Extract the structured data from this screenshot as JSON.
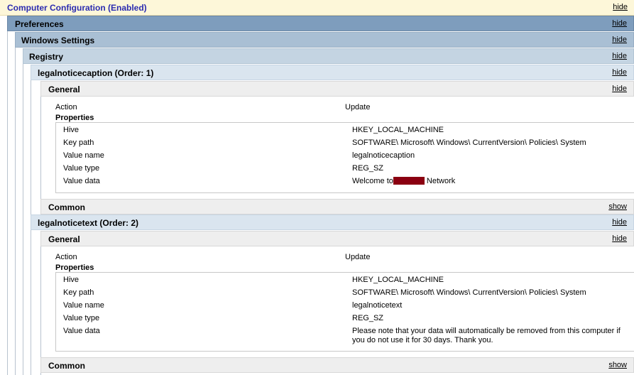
{
  "computer_configuration": {
    "title": "Computer Configuration (Enabled)",
    "toggle": "hide"
  },
  "preferences": {
    "title": "Preferences",
    "toggle": "hide"
  },
  "windows_settings": {
    "title": "Windows Settings",
    "toggle": "hide"
  },
  "registry": {
    "title": "Registry",
    "toggle": "hide"
  },
  "items": [
    {
      "title": "legalnoticecaption (Order: 1)",
      "toggle": "hide",
      "general": {
        "title": "General",
        "toggle": "hide",
        "action_label": "Action",
        "action_value": "Update",
        "properties_label": "Properties",
        "props": [
          {
            "key": "Hive",
            "value": "HKEY_LOCAL_MACHINE"
          },
          {
            "key": "Key path",
            "value": "SOFTWARE\\ Microsoft\\ Windows\\ CurrentVersion\\ Policies\\ System"
          },
          {
            "key": "Value name",
            "value": "legalnoticecaption"
          },
          {
            "key": "Value type",
            "value": "REG_SZ"
          },
          {
            "key": "Value data",
            "value_prefix": "Welcome to",
            "value_suffix": "Network"
          }
        ]
      },
      "common": {
        "title": "Common",
        "toggle": "show"
      }
    },
    {
      "title": "legalnoticetext (Order: 2)",
      "toggle": "hide",
      "general": {
        "title": "General",
        "toggle": "hide",
        "action_label": "Action",
        "action_value": "Update",
        "properties_label": "Properties",
        "props": [
          {
            "key": "Hive",
            "value": "HKEY_LOCAL_MACHINE"
          },
          {
            "key": "Key path",
            "value": "SOFTWARE\\ Microsoft\\ Windows\\ CurrentVersion\\ Policies\\ System"
          },
          {
            "key": "Value name",
            "value": "legalnoticetext"
          },
          {
            "key": "Value type",
            "value": "REG_SZ"
          },
          {
            "key": "Value data",
            "value": "Please note that your data will automatically be removed from this computer if you do not use it for 30 days. Thank you."
          }
        ]
      },
      "common": {
        "title": "Common",
        "toggle": "show"
      }
    }
  ],
  "colors": {
    "redaction": "#8b0011",
    "cc_title": "#2b2bb0"
  }
}
